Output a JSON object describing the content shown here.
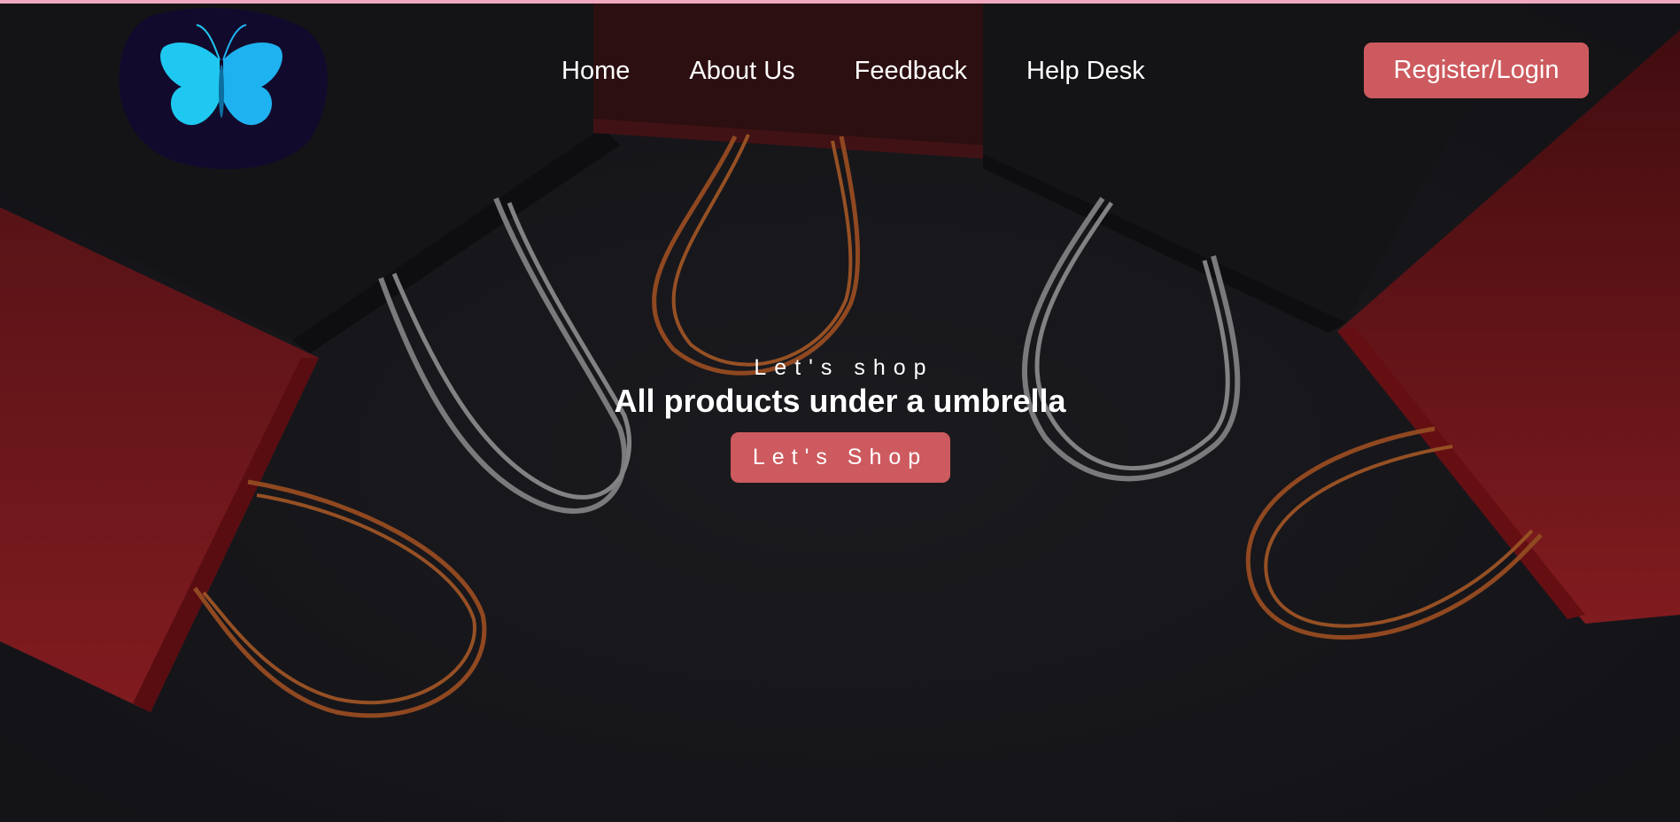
{
  "nav": {
    "links": [
      {
        "label": "Home"
      },
      {
        "label": "About Us"
      },
      {
        "label": "Feedback"
      },
      {
        "label": "Help Desk"
      }
    ],
    "register_label": "Register/Login"
  },
  "hero": {
    "tagline": "Let's shop",
    "headline": "All products under a umbrella",
    "cta_label": "Let's Shop"
  },
  "colors": {
    "accent": "#cd5a5e",
    "logo_blob": "#120a2c",
    "logo_butterfly": "#1fc8f0",
    "top_strip": "#f0a8c0",
    "bag_red": "#b3252b",
    "bag_black": "#1c1c1f",
    "handle_orange": "#c8652d",
    "handle_gray": "#a9a9ad"
  },
  "icons": {
    "logo": "butterfly-logo-icon"
  }
}
